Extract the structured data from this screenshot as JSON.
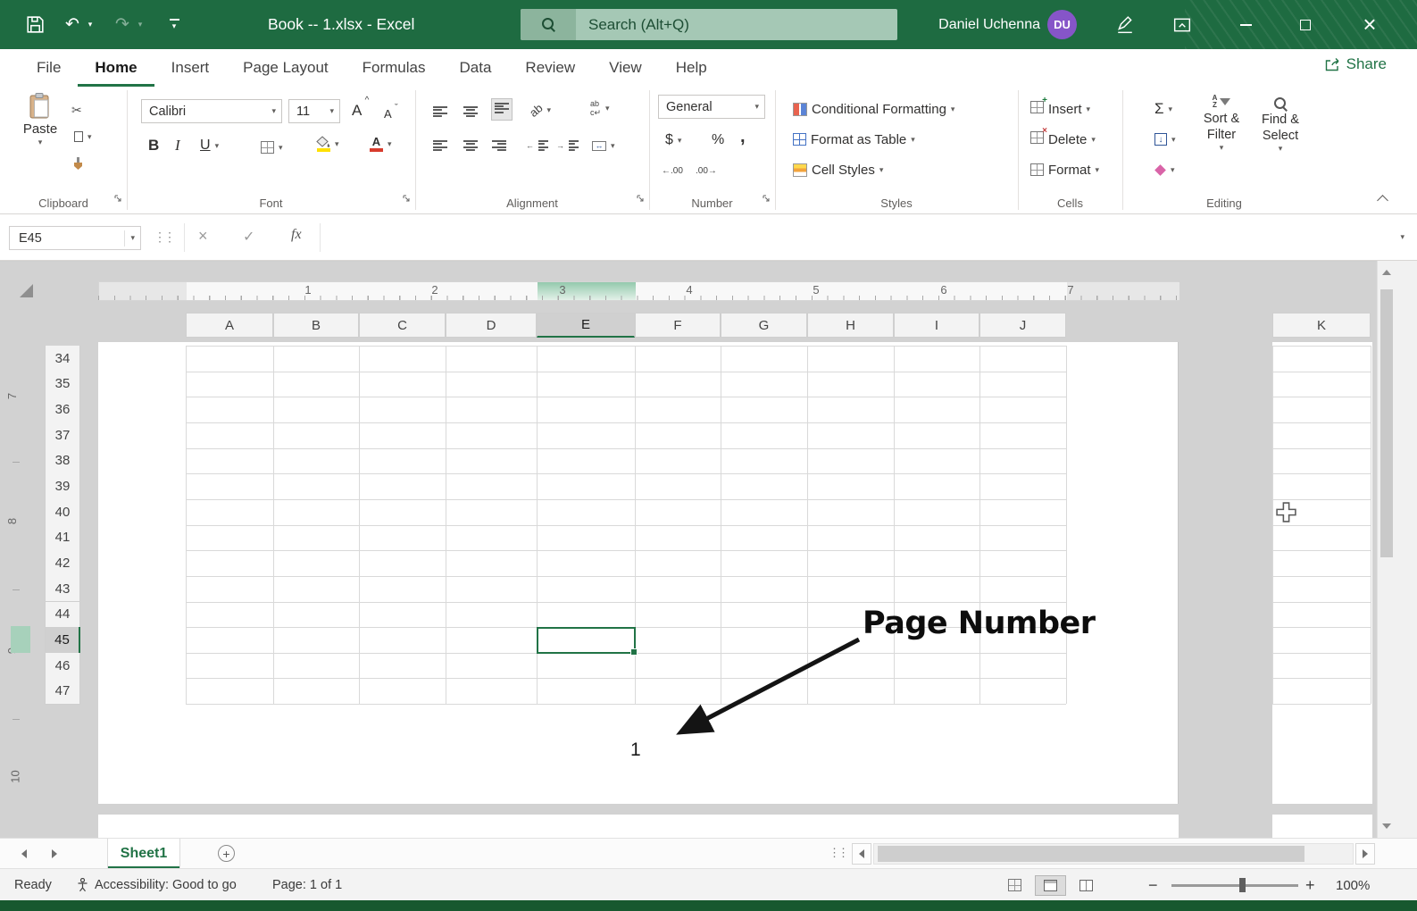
{
  "colors": {
    "titlebar_green": "#1e6b41",
    "accent_green": "#217346",
    "avatar_purple": "#8655c8",
    "search_bg": "#a5c8b5",
    "fill_yellow": "#ffe100",
    "font_red": "#d83b2d"
  },
  "icons": {
    "dropdown": "▾",
    "undo": "↶",
    "redo": "↷",
    "cut": "✂",
    "sum": "Σ",
    "check": "✓",
    "cancel": "×",
    "close": "×",
    "currency": "$",
    "percent": "%",
    "comma": ",",
    "increase_decimal": "←.00",
    "decrease_decimal": ".00→",
    "wrap_return": "↵",
    "merge_arrows": "↔",
    "down_arrow": "↓",
    "dots": "⋮⋮",
    "plus": "+"
  },
  "title_bar": {
    "title": "Book -- 1.xlsx - Excel",
    "search_placeholder": "Search (Alt+Q)",
    "user_name": "Daniel Uchenna",
    "user_initials": "DU"
  },
  "ribbon_tabs": [
    "File",
    "Home",
    "Insert",
    "Page Layout",
    "Formulas",
    "Data",
    "Review",
    "View",
    "Help"
  ],
  "share_label": "Share",
  "ribbon": {
    "groups": {
      "clipboard": {
        "label": "Clipboard",
        "paste": "Paste"
      },
      "font": {
        "label": "Font",
        "font_name": "Calibri",
        "font_size": "11",
        "bold": "B",
        "italic": "I",
        "underline": "U",
        "grow": "A",
        "shrink": "A",
        "color_letter": "A"
      },
      "alignment": {
        "label": "Alignment",
        "orientation_text": "ab",
        "wrap_line1": "ab",
        "wrap_line2": "c"
      },
      "number": {
        "label": "Number",
        "format": "General"
      },
      "styles": {
        "label": "Styles",
        "conditional_formatting": "Conditional Formatting",
        "format_as_table": "Format as Table",
        "cell_styles": "Cell Styles"
      },
      "cells": {
        "label": "Cells",
        "insert": "Insert",
        "delete": "Delete",
        "format": "Format"
      },
      "editing": {
        "label": "Editing",
        "az1": "A",
        "az2": "Z",
        "sort_line1": "Sort &",
        "sort_line2": "Filter",
        "find_line1": "Find &",
        "find_line2": "Select"
      }
    }
  },
  "formula_bar": {
    "name_box": "E45",
    "function_label": "fx"
  },
  "ruler": {
    "h_numbers": [
      "1",
      "2",
      "3",
      "4",
      "5",
      "6",
      "7"
    ],
    "v_numbers": [
      "7",
      "8",
      "9",
      "10"
    ]
  },
  "grid": {
    "columns": [
      "A",
      "B",
      "C",
      "D",
      "E",
      "F",
      "G",
      "H",
      "I",
      "J"
    ],
    "extra_column": "K",
    "rows": [
      "34",
      "35",
      "36",
      "37",
      "38",
      "39",
      "40",
      "41",
      "42",
      "43",
      "44",
      "45",
      "46",
      "47"
    ],
    "selected_cell": "E45",
    "selected_column": "E",
    "selected_row": "45"
  },
  "annotation": {
    "label": "Page Number",
    "page_number": "1"
  },
  "sheet_bar": {
    "active_tab": "Sheet1"
  },
  "status_bar": {
    "mode": "Ready",
    "accessibility": "Accessibility: Good to go",
    "page_info": "Page: 1 of 1",
    "zoom_level": "100%"
  }
}
